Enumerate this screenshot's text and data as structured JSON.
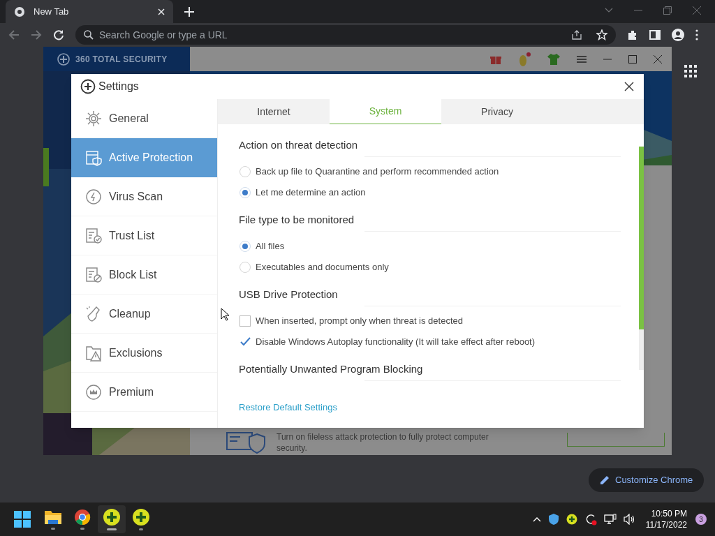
{
  "browser": {
    "tab": {
      "title": "New Tab"
    },
    "address": {
      "placeholder": "Search Google or type a URL"
    },
    "customize_button": "Customize Chrome"
  },
  "app": {
    "title": "360 TOTAL SECURITY",
    "promo_lines": [
      "Turn on fileless attack protection to fully protect computer",
      "security."
    ]
  },
  "dialog": {
    "title": "Settings",
    "sidebar": [
      {
        "label": "General",
        "selected": false
      },
      {
        "label": "Active Protection",
        "selected": true
      },
      {
        "label": "Virus Scan",
        "selected": false
      },
      {
        "label": "Trust List",
        "selected": false
      },
      {
        "label": "Block List",
        "selected": false
      },
      {
        "label": "Cleanup",
        "selected": false
      },
      {
        "label": "Exclusions",
        "selected": false
      },
      {
        "label": "Premium",
        "selected": false
      }
    ],
    "tabs": [
      {
        "label": "Internet",
        "selected": false
      },
      {
        "label": "System",
        "selected": true
      },
      {
        "label": "Privacy",
        "selected": false
      }
    ],
    "sections": [
      {
        "heading": "Action on threat detection",
        "options": [
          {
            "kind": "radio",
            "label": "Back up file to Quarantine and perform recommended action",
            "checked": false
          },
          {
            "kind": "radio",
            "label": "Let me determine an action",
            "checked": true
          }
        ]
      },
      {
        "heading": "File type to be monitored",
        "options": [
          {
            "kind": "radio",
            "label": "All files",
            "checked": true
          },
          {
            "kind": "radio",
            "label": "Executables and documents only",
            "checked": false
          }
        ]
      },
      {
        "heading": "USB Drive Protection",
        "options": [
          {
            "kind": "checkbox",
            "label": "When inserted, prompt only when threat is detected",
            "checked": false
          },
          {
            "kind": "checkbox",
            "label": "Disable Windows Autoplay functionality (It will take effect after reboot)",
            "checked": true
          }
        ]
      },
      {
        "heading": "Potentially Unwanted Program Blocking"
      }
    ],
    "restore_link": "Restore Default Settings"
  },
  "taskbar": {
    "apps": [
      {
        "kind": "folder",
        "selected": false
      },
      {
        "kind": "chrome",
        "selected": false
      },
      {
        "kind": "security",
        "selected": true
      },
      {
        "kind": "security",
        "selected": false
      }
    ],
    "time": "10:50 PM",
    "date": "11/17/2022",
    "notification_count": "3"
  }
}
